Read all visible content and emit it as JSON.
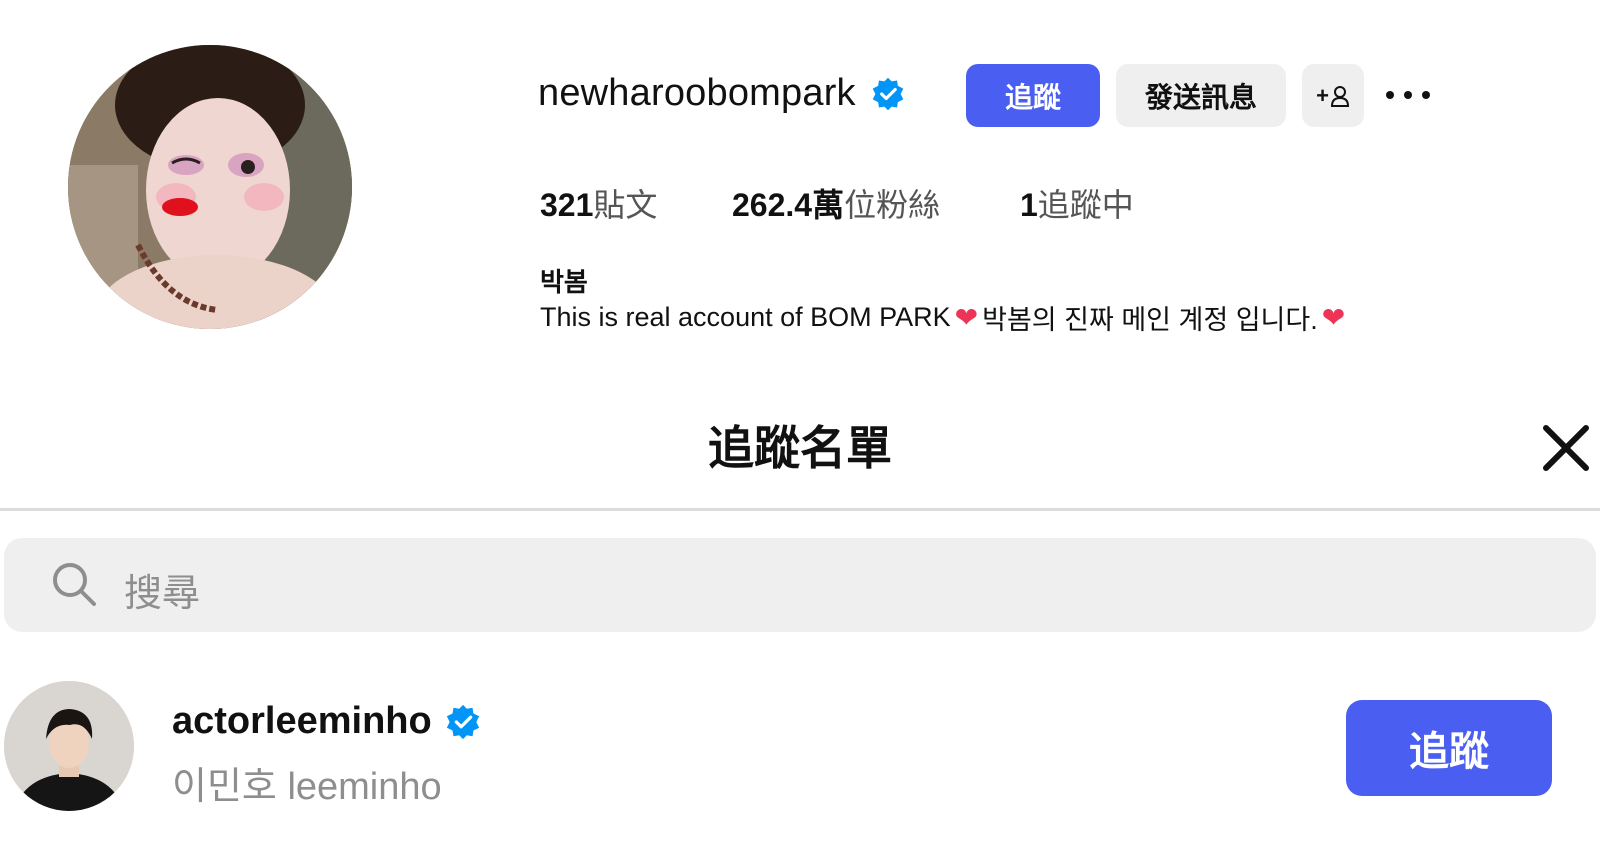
{
  "profile": {
    "username": "newharoobompark",
    "verified": true,
    "follow_label": "追蹤",
    "message_label": "發送訊息",
    "add_user_label": "+",
    "stats": {
      "posts_count": "321",
      "posts_label": "貼文",
      "followers_count": "262.4萬",
      "followers_label": "位粉絲",
      "following_count": "1",
      "following_label": "追蹤中"
    },
    "full_name": "박봄",
    "bio_part1": "This is real account of BOM PARK",
    "bio_part2": "박봄의 진짜 메인 계정 입니다.",
    "bio_emoji": "❤"
  },
  "modal": {
    "title": "追蹤名單",
    "search_placeholder": "搜尋",
    "items": [
      {
        "username": "actorleeminho",
        "verified": true,
        "full_name": "이민호 leeminho",
        "button_label": "追蹤"
      }
    ]
  },
  "colors": {
    "accent": "#4a5ef1",
    "verified": "#0095f6",
    "secondary_bg": "#efefef",
    "muted_text": "#8e8e8e",
    "heart": "#ee3456"
  }
}
